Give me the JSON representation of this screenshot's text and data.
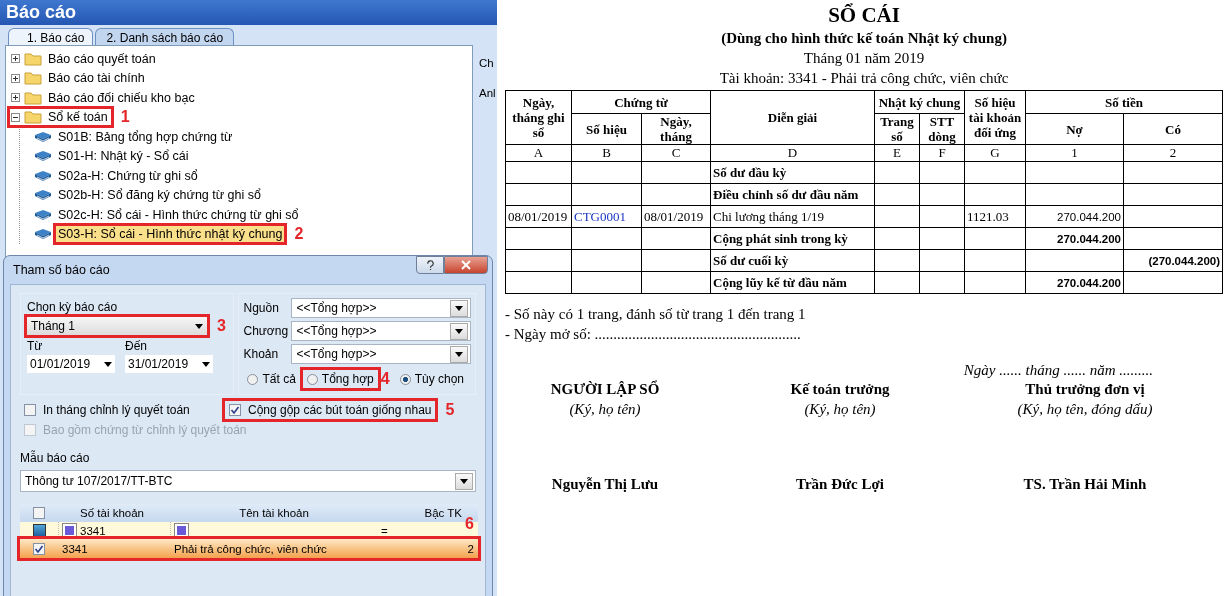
{
  "window": {
    "title": "Báo cáo"
  },
  "tabs": [
    {
      "label": "1. Báo cáo",
      "selected": true
    },
    {
      "label": "2. Danh sách báo cáo",
      "selected": false
    }
  ],
  "tree": [
    {
      "label": "Báo cáo quyết toán",
      "expanded": false,
      "selected": false
    },
    {
      "label": "Báo cáo tài chính",
      "expanded": false,
      "selected": false
    },
    {
      "label": "Báo cáo đối chiếu kho bạc",
      "expanded": false,
      "selected": false
    },
    {
      "label": "Sổ kế toán",
      "expanded": true,
      "selected": false,
      "annotation": "1",
      "children": [
        {
          "label": "S01B: Bảng tổng hợp chứng từ",
          "selected": false
        },
        {
          "label": "S01-H: Nhật ký - Sổ cái",
          "selected": false
        },
        {
          "label": "S02a-H: Chứng từ ghi sổ",
          "selected": false
        },
        {
          "label": "S02b-H: Sổ đăng ký chứng từ ghi sổ",
          "selected": false
        },
        {
          "label": "S02c-H: Sổ cái - Hình thức chứng từ ghi sổ",
          "selected": false
        },
        {
          "label": "S03-H: Sổ cái - Hình thức nhật ký chung",
          "selected": true,
          "annotation": "2"
        }
      ]
    }
  ],
  "side_labels": [
    "Ch",
    "Anl"
  ],
  "dialog": {
    "title": "Tham số báo cáo",
    "period": {
      "label": "Chọn kỳ báo cáo",
      "value": "Tháng 1",
      "annotation": "3"
    },
    "date_from": {
      "label": "Từ",
      "value": "01/01/2019"
    },
    "date_to": {
      "label": "Đến",
      "value": "31/01/2019"
    },
    "filters": [
      {
        "label": "Nguồn",
        "value": "<<Tổng hợp>>"
      },
      {
        "label": "Chương",
        "value": "<<Tổng hợp>>"
      },
      {
        "label": "Khoản",
        "value": "<<Tổng hợp>>"
      }
    ],
    "radios": [
      {
        "label": "Tất cả",
        "selected": false
      },
      {
        "label": "Tổng hợp",
        "selected": false,
        "annotation": "4"
      },
      {
        "label": "Tùy chọn",
        "selected": true
      }
    ],
    "checks": [
      {
        "label": "In tháng chỉnh lý quyết toán",
        "checked": false,
        "disabled": false
      },
      {
        "label": "Cộng gộp các bút toán giống nhau",
        "checked": true,
        "disabled": false,
        "annotation": "5"
      },
      {
        "label": "Bao gồm chứng từ chỉnh lý quyết toán",
        "checked": false,
        "disabled": true
      }
    ],
    "template": {
      "label": "Mẫu báo cáo",
      "value": "Thông tư 107/2017/TT-BTC"
    },
    "grid": {
      "header_checked": false,
      "columns": [
        "Số tài khoản",
        "Tên tài khoản",
        "Bậc TK"
      ],
      "filter": {
        "account": "3341",
        "grade_operator": "="
      },
      "rows": [
        {
          "checked": true,
          "selected": true,
          "account": "3341",
          "name": "Phải trả công chức, viên chức",
          "grade": "2",
          "annotation": "6"
        }
      ]
    }
  },
  "report": {
    "title": "SỔ CÁI",
    "subtitle": "(Dùng cho hình thức kế toán Nhật ký chung)",
    "period": "Tháng 01 năm 2019",
    "account": "Tài khoản: 3341 - Phải trả công chức, viên chức",
    "columns": [
      {
        "label": "Ngày, tháng ghi sổ"
      },
      {
        "label": "Chứng từ",
        "children": [
          {
            "label": "Số hiệu"
          },
          {
            "label": "Ngày, tháng"
          }
        ]
      },
      {
        "label": "Diễn giải"
      },
      {
        "label": "Nhật ký chung",
        "children": [
          {
            "label": "Trang số"
          },
          {
            "label": "STT dòng"
          }
        ]
      },
      {
        "label": "Số hiệu tài khoản đối ứng"
      },
      {
        "label": "Số tiền",
        "children": [
          {
            "label": "Nợ"
          },
          {
            "label": "Có"
          }
        ]
      }
    ],
    "column_codes": [
      "A",
      "B",
      "C",
      "D",
      "E",
      "F",
      "G",
      "1",
      "2"
    ],
    "rows": [
      {
        "kind": "summary",
        "description": "Số dư đầu kỳ"
      },
      {
        "kind": "summary",
        "description": "Điều chỉnh số dư đầu năm"
      },
      {
        "kind": "entry",
        "date": "08/01/2019",
        "doc_no": "CTG0001",
        "doc_date": "08/01/2019",
        "description": "Chi lương tháng 1/19",
        "contra": "1121.03",
        "debit": "270.044.200"
      },
      {
        "kind": "summary",
        "description": "Cộng phát sinh trong kỳ",
        "debit": "270.044.200"
      },
      {
        "kind": "summary",
        "description": "Số dư cuối kỳ",
        "credit": "(270.044.200)"
      },
      {
        "kind": "summary",
        "description": "Cộng lũy kế từ đầu năm",
        "debit": "270.044.200"
      }
    ],
    "notes": [
      "- Số này có 1 trang, đánh số từ trang 1 đến trang 1",
      "- Ngày mở số: ......................................................."
    ],
    "sign_date": "Ngày ...... tháng ...... năm .........",
    "signers": [
      {
        "title": "NGƯỜI LẬP SỔ",
        "note": "(Ký, họ tên)",
        "name": "Nguyễn Thị Lưu"
      },
      {
        "title": "Kế toán trưởng",
        "note": "(Ký, họ tên)",
        "name": "Trần Đức Lợi"
      },
      {
        "title": "Thủ trưởng đơn vị",
        "note": "(Ký, họ tên, đóng dấu)",
        "name": "TS. Trần Hải Minh"
      }
    ]
  }
}
